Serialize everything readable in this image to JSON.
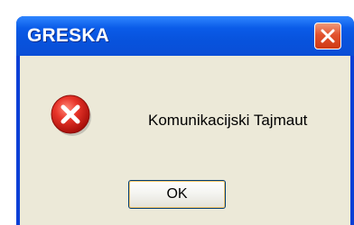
{
  "dialog": {
    "title": "GRESKA",
    "close_icon": "close-icon",
    "icon": "error-icon",
    "message": "Komunikacijski Tajmaut",
    "ok_label": "OK"
  },
  "colors": {
    "titlebar": "#0a5be8",
    "client_background": "#ece9d8",
    "close_button": "#e2522e",
    "error_icon": "#d8261c"
  }
}
